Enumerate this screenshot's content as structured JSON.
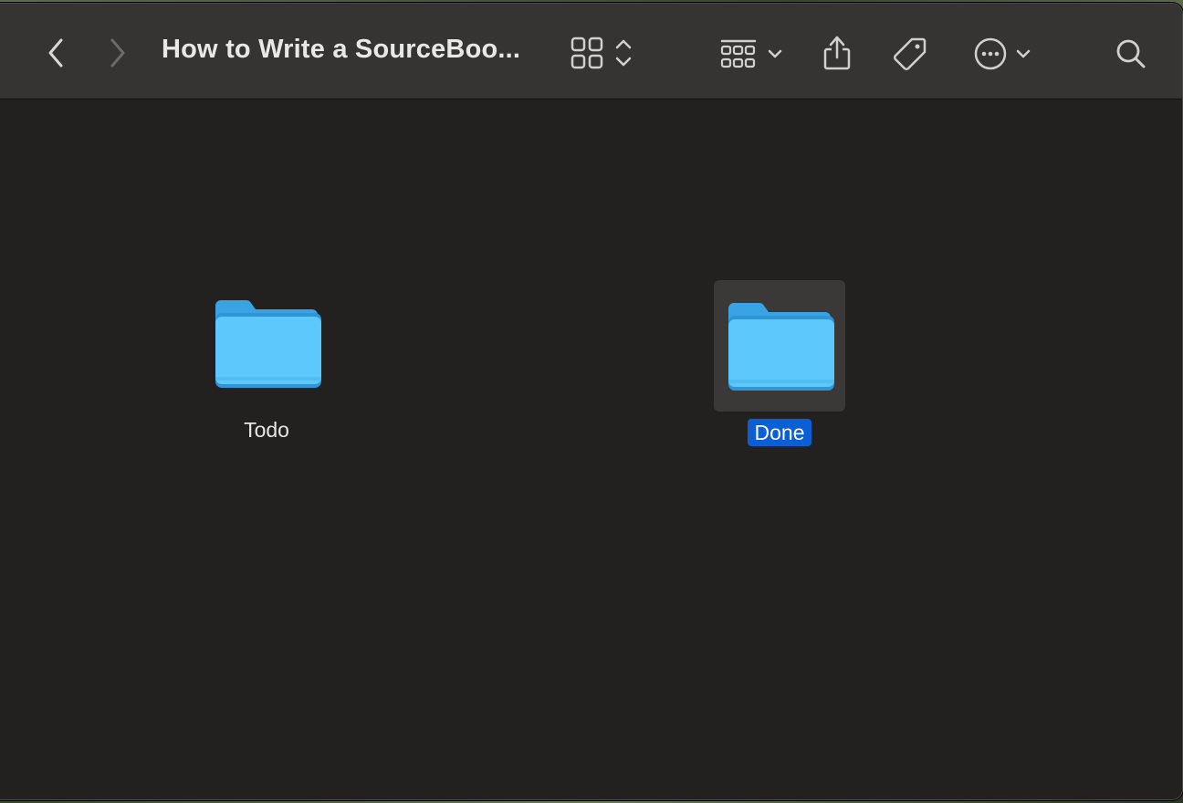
{
  "window": {
    "title": "How to Write a SourceBoo..."
  },
  "toolbar": {
    "back_icon": "chevron-left-icon",
    "forward_icon": "chevron-right-icon",
    "view_mode_icon": "grid-view-icon",
    "group_icon": "group-grid-icon",
    "share_icon": "share-icon",
    "tag_icon": "tag-icon",
    "more_icon": "ellipsis-circle-icon",
    "search_icon": "search-icon"
  },
  "items": [
    {
      "label": "Todo",
      "icon": "folder-icon",
      "selected": false
    },
    {
      "label": "Done",
      "icon": "folder-icon",
      "selected": true
    }
  ],
  "colors": {
    "folder_blue": "#5cc8fb",
    "selection_blue": "#0a5fd4",
    "window_bg": "#222120",
    "toolbar_bg": "#353433"
  }
}
